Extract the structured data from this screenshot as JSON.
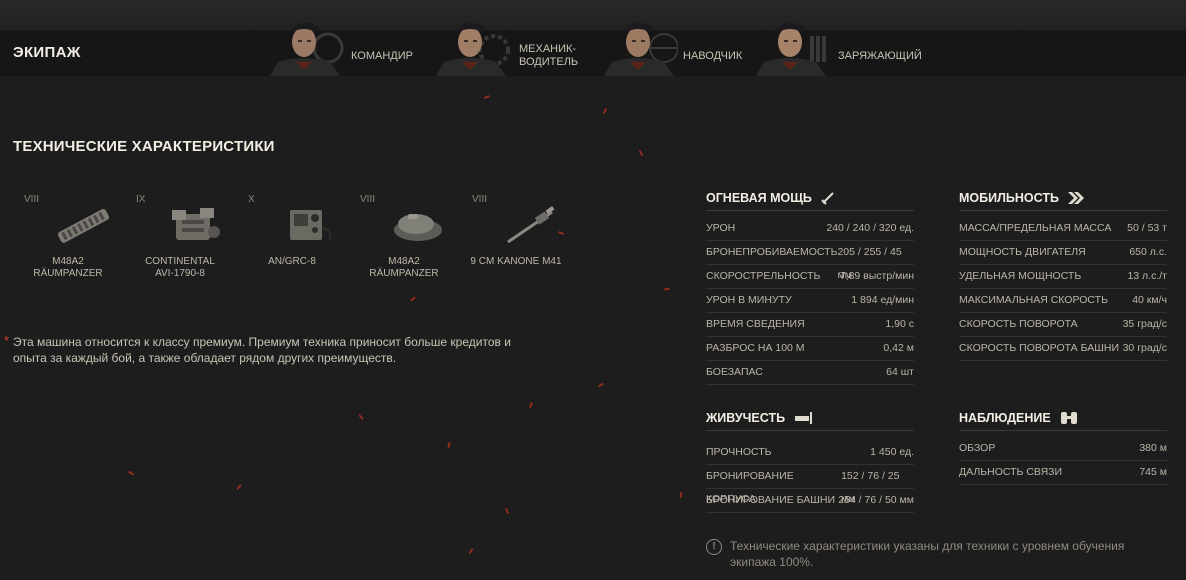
{
  "crew": {
    "title": "ЭКИПАЖ",
    "members": [
      {
        "role": "КОМАНДИР"
      },
      {
        "role": "МЕХАНИК-\nВОДИТЕЛЬ"
      },
      {
        "role": "НАВОДЧИК"
      },
      {
        "role": "ЗАРЯЖАЮЩИЙ"
      }
    ]
  },
  "specs": {
    "title": "ТЕХНИЧЕСКИЕ ХАРАКТЕРИСТИКИ",
    "modules": [
      {
        "tier": "VIII",
        "name": "M48A2\nRÄUMPANZER",
        "icon": "tracks-icon"
      },
      {
        "tier": "IX",
        "name": "CONTINENTAL\nAVI-1790-8",
        "icon": "engine-icon"
      },
      {
        "tier": "X",
        "name": "AN/GRC-8",
        "icon": "radio-icon"
      },
      {
        "tier": "VIII",
        "name": "M48A2\nRÄUMPANZER",
        "icon": "turret-icon"
      },
      {
        "tier": "VIII",
        "name": "9 CM KANONE M41",
        "icon": "gun-icon"
      }
    ],
    "premium_note": "Эта машина относится к классу премиум. Премиум техника приносит больше кредитов и опыта за каждый бой, а также обладает рядом других преимуществ."
  },
  "firepower": {
    "title": "ОГНЕВАЯ МОЩЬ",
    "rows": [
      {
        "label": "УРОН",
        "value": "240 / 240 / 320 ед."
      },
      {
        "label": "БРОНЕПРОБИВАЕМОСТЬ",
        "value": "205 / 255 / 45 мм"
      },
      {
        "label": "СКОРОСТРЕЛЬНОСТЬ",
        "value": "7,89 выстр/мин"
      },
      {
        "label": "УРОН В МИНУТУ",
        "value": "1 894 ед/мин"
      },
      {
        "label": "ВРЕМЯ СВЕДЕНИЯ",
        "value": "1,90 с"
      },
      {
        "label": "РАЗБРОС НА 100 М",
        "value": "0,42 м"
      },
      {
        "label": "БОЕЗАПАС",
        "value": "64 шт"
      }
    ]
  },
  "survivability": {
    "title": "ЖИВУЧЕСТЬ",
    "rows": [
      {
        "label": "ПРОЧНОСТЬ",
        "value": "1 450 ед."
      },
      {
        "label": "БРОНИРОВАНИЕ КОРПУСА",
        "value": "152 / 76 / 25 мм"
      },
      {
        "label": "БРОНИРОВАНИЕ БАШНИ",
        "value": "254 / 76 / 50 мм"
      }
    ]
  },
  "mobility": {
    "title": "МОБИЛЬНОСТЬ",
    "rows": [
      {
        "label": "МАССА/ПРЕДЕЛЬНАЯ МАССА",
        "value": "50 / 53 т"
      },
      {
        "label": "МОЩНОСТЬ ДВИГАТЕЛЯ",
        "value": "650 л.с."
      },
      {
        "label": "УДЕЛЬНАЯ МОЩНОСТЬ",
        "value": "13 л.с./т"
      },
      {
        "label": "МАКСИМАЛЬНАЯ СКОРОСТЬ",
        "value": "40 км/ч"
      },
      {
        "label": "СКОРОСТЬ ПОВОРОТА",
        "value": "35 град/с"
      },
      {
        "label": "СКОРОСТЬ ПОВОРОТА БАШНИ",
        "value": "30 град/с"
      }
    ]
  },
  "observation": {
    "title": "НАБЛЮДЕНИЕ",
    "rows": [
      {
        "label": "ОБЗОР",
        "value": "380 м"
      },
      {
        "label": "ДАЛЬНОСТЬ СВЯЗИ",
        "value": "745 м"
      }
    ]
  },
  "footer_note": "Технические характеристики указаны для техники с уровнем обучения экипажа 100%.",
  "colors": {
    "accent_red": "#d2402a",
    "title": "#f2eee4",
    "text": "#c9c4b6"
  }
}
